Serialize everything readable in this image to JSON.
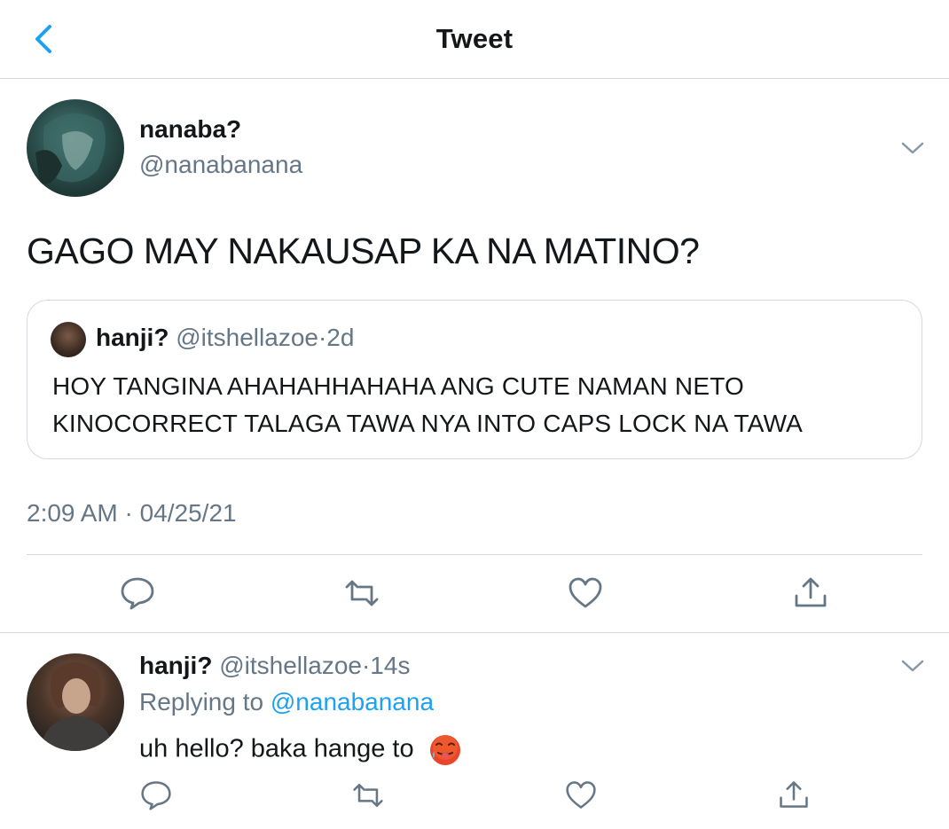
{
  "header": {
    "title": "Tweet",
    "back_icon": "chevron-left-icon"
  },
  "tweet": {
    "author_name": "nanaba?",
    "author_handle": "@nanabanana",
    "text": "GAGO MAY NAKAUSAP KA NA MATINO?",
    "quoted": {
      "author_name": "hanji?",
      "author_handle": "@itshellazoe",
      "separator": "·",
      "age": "2d",
      "line1": "HOY TANGINA AHAHAHHAHAHA ANG CUTE NAMAN NETO",
      "line2": "KINOCORRECT TALAGA TAWA NYA INTO CAPS LOCK NA TAWA"
    },
    "timestamp": "2:09 AM · 04/25/21",
    "actions": [
      "reply-icon",
      "retweet-icon",
      "like-icon",
      "share-icon"
    ]
  },
  "reply": {
    "author_name": "hanji?",
    "author_handle": "@itshellazoe",
    "separator": "·",
    "age": "14s",
    "replying_label": "Replying to",
    "replying_handle": "@nanabanana",
    "text": "uh hello? baka hange to",
    "emoji": "hot-face-emoji"
  },
  "colors": {
    "accent": "#1da1f2",
    "muted": "#657786",
    "text": "#14171a",
    "border": "#d5d9dd"
  }
}
